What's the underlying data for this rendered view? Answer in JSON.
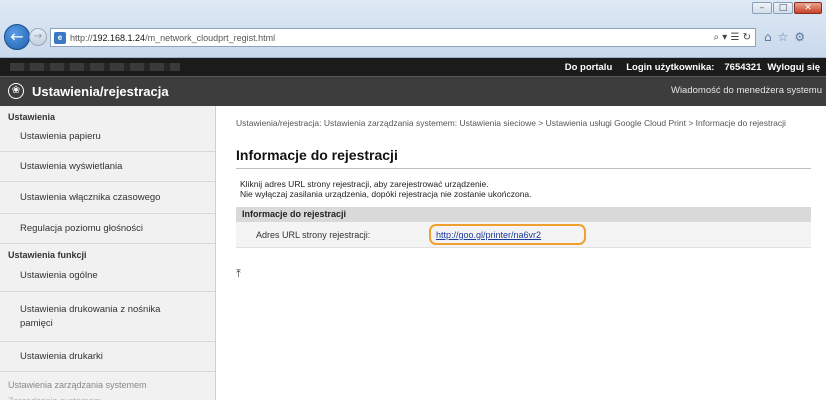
{
  "browser": {
    "url_prefix": "http://",
    "url_host": "192.168.1.24",
    "url_path": "/m_network_cloudprt_regist.html",
    "address_tools": "⌕ ▾ ☰ ↻",
    "toolbar_icons": [
      "⌂",
      "☆",
      "⚙"
    ],
    "window_controls": [
      "–",
      "□",
      "✕"
    ]
  },
  "topbar": {
    "portal_link": "Do portalu",
    "login_label": "Login użytkownika:",
    "user_id": "7654321",
    "logout_link": "Wyloguj się"
  },
  "titlebar": {
    "title": "Ustawienia/rejestracja",
    "admin_message": "Wiadomość do menedżera systemu",
    "icon": "settings-icon"
  },
  "sidebar": {
    "section_settings": "Ustawienia",
    "settings_items": [
      "Ustawienia papieru",
      "Ustawienia wyświetlania",
      "Ustawienia włącznika czasowego",
      "Regulacja poziomu głośności"
    ],
    "section_functions": "Ustawienia funkcji",
    "function_items": [
      "Ustawienia ogólne",
      "Ustawienia drukowania z nośnika pamięci",
      "Ustawienia drukarki"
    ],
    "section_system": "Ustawienia zarządzania systemem",
    "section_faint": "Zarządzanie systemem"
  },
  "main": {
    "breadcrumb": "Ustawienia/rejestracja: Ustawienia zarządzania systemem: Ustawienia sieciowe > Ustawienia usługi Google Cloud Print > Informacje do rejestracji",
    "title": "Informacje do rejestracji",
    "instruction_line1": "Kliknij adres URL strony rejestracji, aby zarejestrować urządzenie.",
    "instruction_line2": "Nie wyłączaj zasilania urządzenia, dopóki rejestracja nie zostanie ukończona.",
    "table_header": "Informacje do rejestracji",
    "url_label": "Adres URL strony rejestracji:",
    "url_value": "http://goo.gl/printer/na6vr2",
    "top_glyph": "⤒"
  },
  "colors": {
    "highlight": "#f0a030",
    "link": "#1a3a9c",
    "header_dark": "#3d3d3d"
  }
}
